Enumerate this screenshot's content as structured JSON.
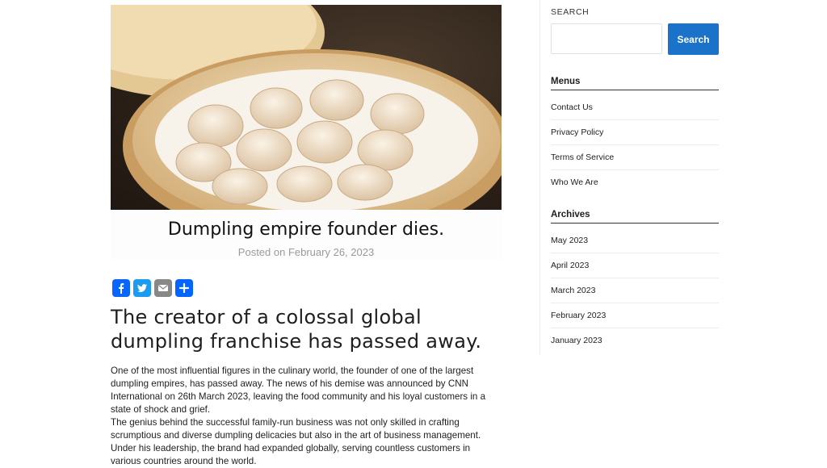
{
  "post": {
    "title": "Dumpling empire founder dies.",
    "meta": "Posted on February 26, 2023",
    "headline": "The creator of a colossal global dumpling franchise has passed away.",
    "paragraphs": [
      "One of the most influential figures in the culinary world, the founder of one of the largest dumpling empires, has passed away. The news of his demise was announced by CNN International on 26th March 2023, leaving the food community and his loyal customers in a state of shock and grief.",
      "The genius behind the successful family-run business was not only skilled in crafting scrumptious and diverse dumpling delicacies but also in the art of business management. Under his leadership, the brand had expanded globally, serving countless customers in various countries around the world."
    ]
  },
  "share": {
    "icons": [
      "facebook-icon",
      "twitter-icon",
      "email-icon",
      "share-icon"
    ],
    "colors": [
      "#0866ff",
      "#1d9bf0",
      "#888888",
      "#0166ff"
    ]
  },
  "sidebar": {
    "search": {
      "label": "SEARCH",
      "placeholder": "",
      "value": "",
      "button": "Search"
    },
    "menus": {
      "title": "Menus",
      "items": [
        "Contact Us",
        "Privacy Policy",
        "Terms of Service",
        "Who We Are"
      ]
    },
    "archives": {
      "title": "Archives",
      "items": [
        "May 2023",
        "April 2023",
        "March 2023",
        "February 2023",
        "January 2023"
      ]
    }
  },
  "colors": {
    "accent": "#1a73c9"
  }
}
